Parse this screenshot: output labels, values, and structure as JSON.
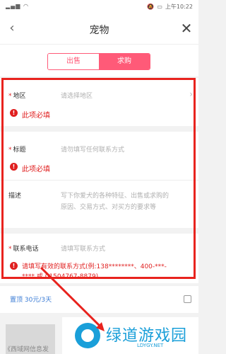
{
  "status": {
    "time": "上午10:22"
  },
  "nav": {
    "title": "宠物",
    "back_icon": "‹",
    "close_icon": "✕"
  },
  "tabs": [
    {
      "label": "出售"
    },
    {
      "label": "求购"
    }
  ],
  "form": {
    "region": {
      "label": "地区",
      "placeholder": "请选择地区",
      "error": "此项必填"
    },
    "title": {
      "label": "标题",
      "placeholder": "请勿填写任何联系方式",
      "error": "此项必填"
    },
    "desc": {
      "label": "描述",
      "placeholder_line1": "写下你爱犬的各种特征、出售或求购的",
      "placeholder_line2": "原因、交易方式、对买方的要求等"
    },
    "phone": {
      "label": "联系电话",
      "placeholder": "请填写联系方式",
      "error_line1": "请填写有效的联系方式(例:138********、400-***-",
      "error_line2": "**** 或 01504767-8879)"
    }
  },
  "required_mark": "*",
  "error_icon": "!",
  "promote": {
    "label": "置顶 30元/3天"
  },
  "bottom": {
    "text": "《西域网信息发"
  },
  "watermark": {
    "text": "绿道游戏园",
    "sub": "LDYGY.NET"
  }
}
